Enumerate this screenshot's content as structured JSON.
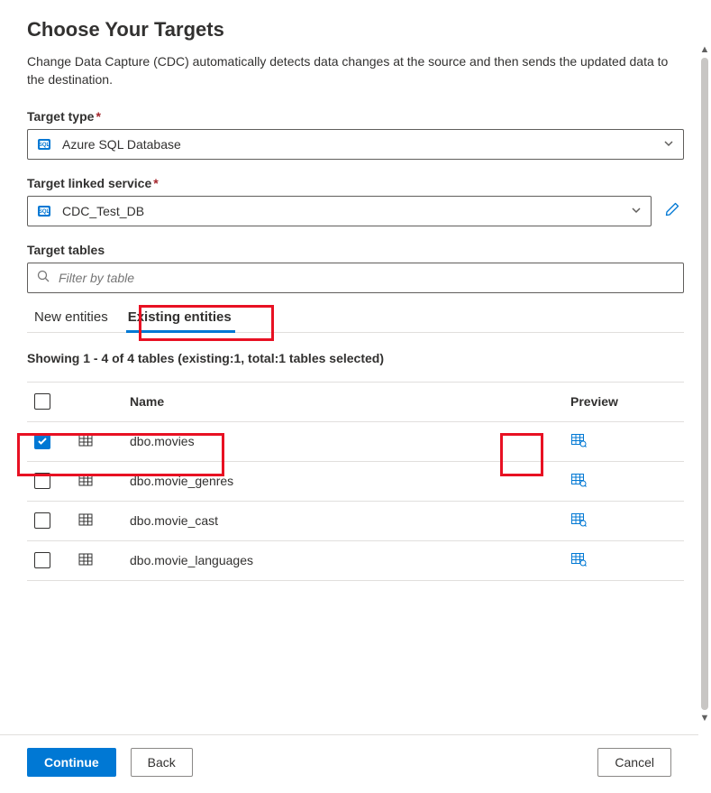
{
  "header": {
    "title": "Choose Your Targets",
    "description": "Change Data Capture (CDC) automatically detects data changes at the source and then sends the updated data to the destination."
  },
  "target_type": {
    "label": "Target type",
    "value": "Azure SQL Database"
  },
  "linked_service": {
    "label": "Target linked service",
    "value": "CDC_Test_DB"
  },
  "tables_section": {
    "label": "Target tables",
    "filter_placeholder": "Filter by table"
  },
  "tabs": {
    "new": "New entities",
    "existing": "Existing entities"
  },
  "summary": "Showing 1 - 4 of 4 tables (existing:1, total:1 tables selected)",
  "columns": {
    "name": "Name",
    "preview": "Preview"
  },
  "rows": [
    {
      "name": "dbo.movies",
      "checked": true
    },
    {
      "name": "dbo.movie_genres",
      "checked": false
    },
    {
      "name": "dbo.movie_cast",
      "checked": false
    },
    {
      "name": "dbo.movie_languages",
      "checked": false
    }
  ],
  "footer": {
    "continue": "Continue",
    "back": "Back",
    "cancel": "Cancel"
  }
}
